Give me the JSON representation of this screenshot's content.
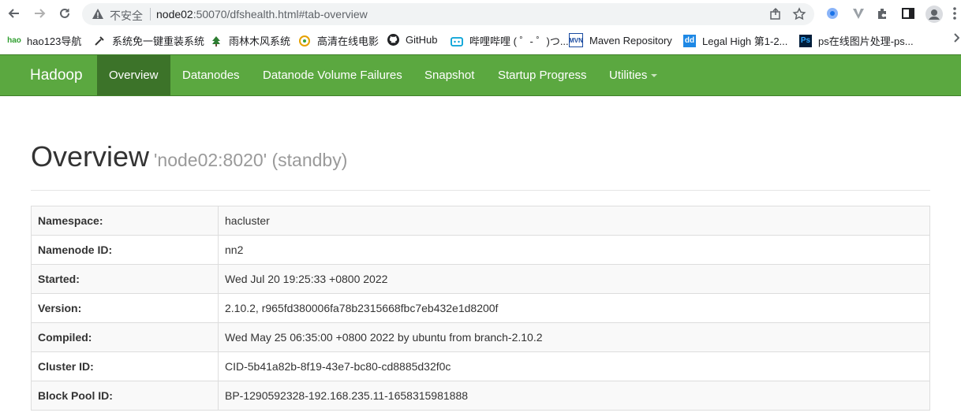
{
  "browser": {
    "security_label": "不安全",
    "url_host": "node02",
    "url_rest": ":50070/dfshealth.html#tab-overview",
    "icons": [
      "back-icon",
      "forward-icon",
      "reload-icon",
      "warning-icon",
      "share-icon",
      "star-icon",
      "extensions-icon",
      "sidepanel-icon",
      "profile-icon",
      "menu-icon"
    ]
  },
  "bookmarks": [
    {
      "label": "hao123导航",
      "icon": "hao123-icon"
    },
    {
      "label": "系统免一键重装系统",
      "icon": "tool-icon"
    },
    {
      "label": "雨林木风系统",
      "icon": "tree-icon"
    },
    {
      "label": "高清在线电影",
      "icon": "movie-icon"
    },
    {
      "label": "GitHub",
      "icon": "github-icon"
    },
    {
      "label": "哔哩哔哩 ( ゜- ゜)つ...",
      "icon": "bilibili-icon"
    },
    {
      "label": "Maven Repository",
      "icon": "maven-icon"
    },
    {
      "label": "Legal High 第1-2...",
      "icon": "dd-icon"
    },
    {
      "label": "ps在线图片处理-ps...",
      "icon": "ps-icon"
    }
  ],
  "nav": {
    "brand": "Hadoop",
    "items": [
      "Overview",
      "Datanodes",
      "Datanode Volume Failures",
      "Snapshot",
      "Startup Progress",
      "Utilities"
    ],
    "active": "Overview"
  },
  "page": {
    "title": "Overview",
    "subtitle": "'node02:8020' (standby)"
  },
  "table": [
    {
      "key": "Namespace:",
      "value": "hacluster"
    },
    {
      "key": "Namenode ID:",
      "value": "nn2"
    },
    {
      "key": "Started:",
      "value": "Wed Jul 20 19:25:33 +0800 2022"
    },
    {
      "key": "Version:",
      "value": "2.10.2, r965fd380006fa78b2315668fbc7eb432e1d8200f"
    },
    {
      "key": "Compiled:",
      "value": "Wed May 25 06:35:00 +0800 2022 by ubuntu from branch-2.10.2"
    },
    {
      "key": "Cluster ID:",
      "value": "CID-5b41a82b-8f19-43e7-bc80-cd8885d32f0c"
    },
    {
      "key": "Block Pool ID:",
      "value": "BP-1290592328-192.168.235.11-1658315981888"
    }
  ],
  "colors": {
    "nav_bg": "#5ba840",
    "nav_active": "#3c7329"
  }
}
